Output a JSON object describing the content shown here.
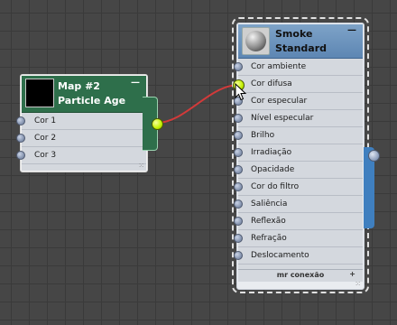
{
  "node_left": {
    "title_line1": "Map #2",
    "title_line2": "Particle Age",
    "minimize": "—",
    "inputs": [
      "Cor 1",
      "Cor 2",
      "Cor 3"
    ],
    "grip": "⁙"
  },
  "node_right": {
    "title_line1": "Smoke",
    "title_line2": "Standard",
    "minimize": "—",
    "inputs": [
      "Cor ambiente",
      "Cor difusa",
      "Cor especular",
      "Nível especular",
      "Brilho",
      "Irradiação",
      "Opacidade",
      "Cor do filtro",
      "Saliência",
      "Reflexão",
      "Refração",
      "Deslocamento"
    ],
    "footer": "mr conexão",
    "footer_plus": "+",
    "grip": "⁙"
  },
  "colors": {
    "wire": "#d23a3a",
    "active_port": "#c3f000",
    "left_header": "#2e6f4b",
    "right_header": "#5d86b3"
  },
  "icons": {
    "cursor": "arrow-pointer-icon",
    "material_preview": "sphere-icon"
  }
}
